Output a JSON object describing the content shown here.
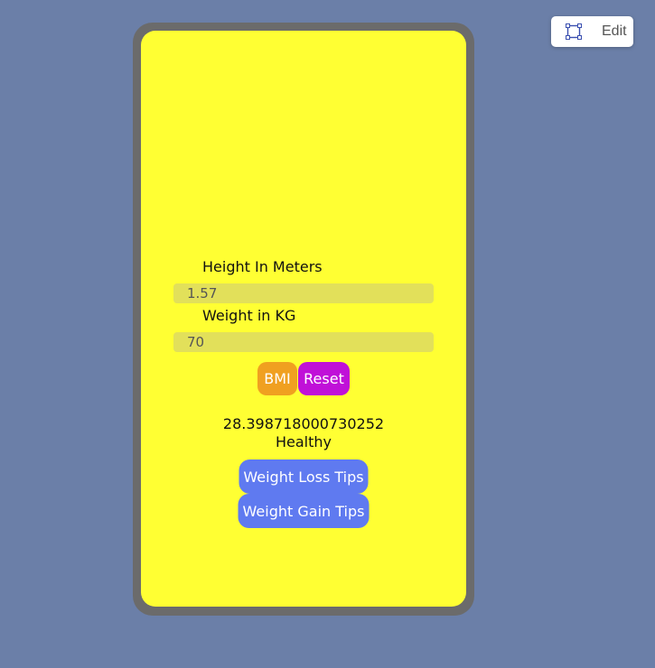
{
  "edit_button": {
    "label": "Edit",
    "icon": "edit-frame-icon"
  },
  "form": {
    "height_label": "Height In Meters",
    "height_value": "1.57",
    "weight_label": "Weight in KG",
    "weight_value": "70"
  },
  "actions": {
    "bmi_label": "BMI",
    "reset_label": "Reset"
  },
  "result": {
    "value": "28.398718000730252",
    "status": "Healthy"
  },
  "tips": {
    "loss_label": "Weight Loss Tips",
    "gain_label": "Weight Gain Tips"
  },
  "colors": {
    "background": "#6b7fa8",
    "frame": "#6b6b6b",
    "screen": "#ffff33",
    "input": "#e2e05a",
    "bmi_button": "#f0a020",
    "reset_button": "#c010d8",
    "tips_button": "#5f7af0"
  }
}
